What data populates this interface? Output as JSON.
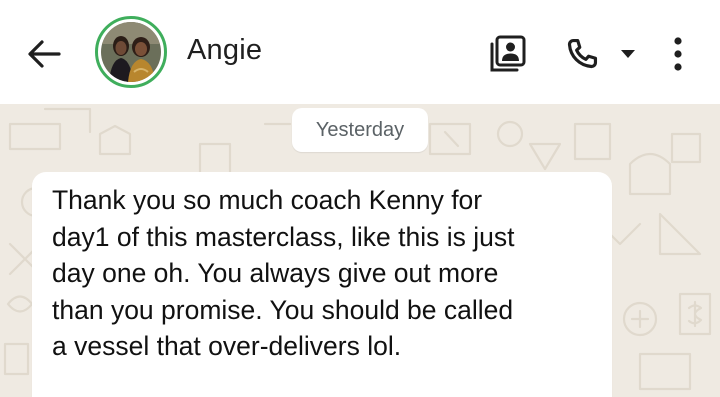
{
  "header": {
    "contact_name": "Angie",
    "icons": {
      "back": "arrow-left-icon",
      "contact_card": "contact-card-icon",
      "call": "phone-icon",
      "call_options": "caret-down-icon",
      "menu": "more-vertical-icon"
    },
    "avatar_ring_color": "#3fae5c"
  },
  "chat": {
    "date_separator": "Yesterday",
    "messages": [
      {
        "direction": "incoming",
        "text": "Thank you so much coach Kenny for\nday1 of this masterclass, like this is just\nday one oh. You always give out more\nthan you promise. You should be called\na vessel that over-delivers lol."
      }
    ],
    "wallpaper_color": "#efeae2"
  }
}
